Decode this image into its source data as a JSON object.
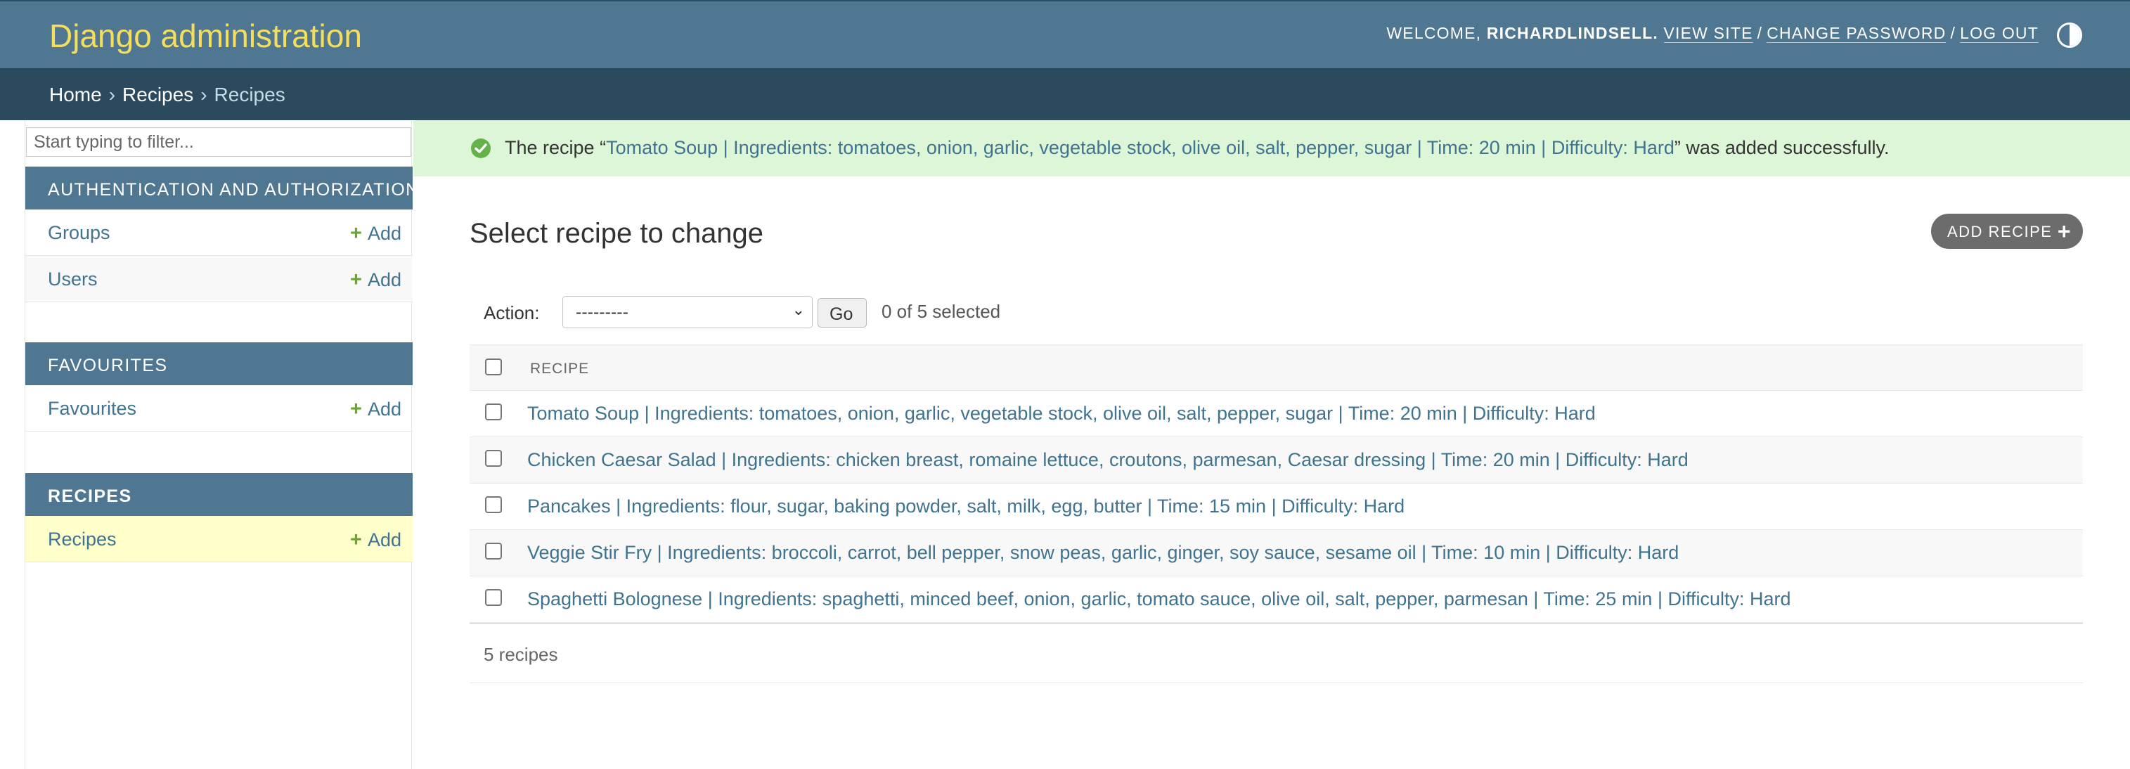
{
  "header": {
    "branding": "Django administration",
    "welcome": "WELCOME,",
    "username": "RICHARDLINDSELL.",
    "view_site": "VIEW SITE",
    "change_password": "CHANGE PASSWORD",
    "log_out": "LOG OUT",
    "separator": "/",
    "theme_toggle_icon": "contrast-half-circle-icon"
  },
  "breadcrumbs": {
    "home": "Home",
    "app": "Recipes",
    "current": "Recipes",
    "separator": "›"
  },
  "sidebar": {
    "filter_placeholder": "Start typing to filter...",
    "apps": [
      {
        "caption": "Authentication and Authorization",
        "models": [
          {
            "name": "Groups",
            "add": "Add"
          },
          {
            "name": "Users",
            "add": "Add"
          }
        ]
      },
      {
        "caption": "Favourites",
        "models": [
          {
            "name": "Favourites",
            "add": "Add"
          }
        ]
      },
      {
        "caption": "Recipes",
        "models": [
          {
            "name": "Recipes",
            "add": "Add"
          }
        ]
      }
    ]
  },
  "message": {
    "prefix": "The recipe “",
    "link": "Tomato Soup | Ingredients: tomatoes, onion, garlic, vegetable stock, olive oil, salt, pepper, sugar | Time: 20 min | Difficulty: Hard",
    "suffix": "” was added successfully.",
    "icon": "success-check-icon"
  },
  "main": {
    "title": "Select recipe to change",
    "add_button": "ADD RECIPE",
    "actions": {
      "label": "Action:",
      "selected_option": "---------",
      "go": "Go",
      "selection_count": "0 of 5 selected"
    },
    "table": {
      "column_header": "RECIPE",
      "rows": [
        "Tomato Soup | Ingredients: tomatoes, onion, garlic, vegetable stock, olive oil, salt, pepper, sugar | Time: 20 min | Difficulty: Hard",
        "Chicken Caesar Salad | Ingredients: chicken breast, romaine lettuce, croutons, parmesan, Caesar dressing | Time: 20 min | Difficulty: Hard",
        "Pancakes | Ingredients: flour, sugar, baking powder, salt, milk, egg, butter | Time: 15 min | Difficulty: Hard",
        "Veggie Stir Fry | Ingredients: broccoli, carrot, bell pepper, snow peas, garlic, ginger, soy sauce, sesame oil | Time: 10 min | Difficulty: Hard",
        "Spaghetti Bolognese | Ingredients: spaghetti, minced beef, onion, garlic, tomato sauce, olive oil, salt, pepper, parmesan | Time: 25 min | Difficulty: Hard"
      ]
    },
    "paginator": "5 recipes"
  },
  "colors": {
    "header_bg": "#4f7791",
    "branding": "#f5dd5d",
    "breadcrumbs_bg": "#2b4a5d",
    "link": "#3f7390",
    "success_bg": "#ddf6d8",
    "add_plus": "#6aa62f",
    "current_row": "#ffffcc"
  }
}
